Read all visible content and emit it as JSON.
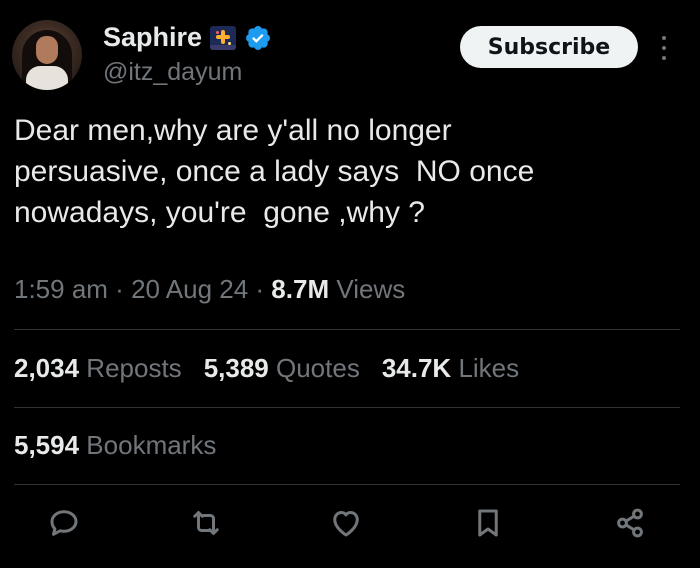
{
  "profile": {
    "display_name": "Saphire",
    "handle": "@itz_dayum",
    "name_emoji": "fireworks-emoji",
    "verified": true
  },
  "header": {
    "subscribe_label": "Subscribe"
  },
  "tweet": {
    "text": "Dear men,why are y'all no longer\npersuasive, once a lady says  NO once\nnowadays, you're  gone ,why ?",
    "time": "1:59 am",
    "sep1": " · ",
    "date": "20 Aug 24",
    "sep2": " · ",
    "views_count": "8.7M",
    "views_label": " Views"
  },
  "stats": {
    "reposts_count": "2,034",
    "reposts_label": " Reposts",
    "quotes_count": "5,389",
    "quotes_label": " Quotes",
    "likes_count": "34.7K",
    "likes_label": " Likes",
    "bookmarks_count": "5,594",
    "bookmarks_label": " Bookmarks"
  },
  "actions": [
    "reply-icon",
    "repost-icon",
    "like-icon",
    "bookmark-icon",
    "share-icon"
  ],
  "colors": {
    "background": "#000000",
    "primary_text": "#e7e9ea",
    "secondary_text": "#71767b",
    "divider": "#2f3336",
    "verified_badge": "#1d9bf0",
    "subscribe_bg": "#eff3f4"
  }
}
